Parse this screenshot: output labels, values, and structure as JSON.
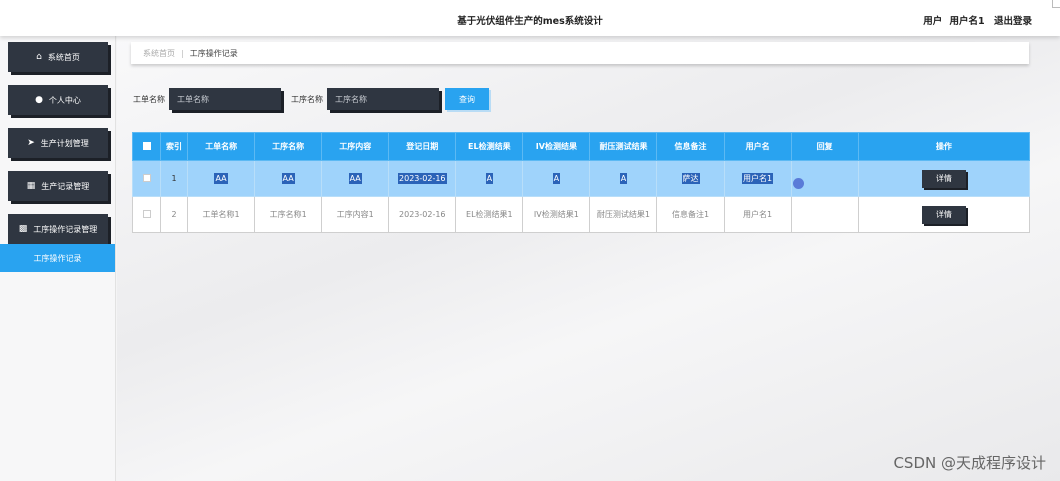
{
  "header": {
    "title": "基于光伏组件生产的mes系统设计",
    "user_label": "用户",
    "user_name": "用户名1",
    "logout": "退出登录"
  },
  "sidebar": {
    "items": [
      {
        "label": "系统首页",
        "icon": "home-icon"
      },
      {
        "label": "个人中心",
        "icon": "user-icon"
      },
      {
        "label": "生产计划管理",
        "icon": "send-icon"
      },
      {
        "label": "生产记录管理",
        "icon": "grid-icon"
      },
      {
        "label": "工序操作记录管理",
        "icon": "clipboard-icon"
      }
    ],
    "active_sub": "工序操作记录"
  },
  "breadcrumb": {
    "home": "系统首页",
    "current": "工序操作记录"
  },
  "search": {
    "field1_label": "工单名称",
    "field1_placeholder": "工单名称",
    "field2_label": "工序名称",
    "field2_placeholder": "工序名称",
    "button": "查询"
  },
  "table": {
    "columns": [
      "索引",
      "工单名称",
      "工序名称",
      "工序内容",
      "登记日期",
      "EL检测结果",
      "IV检测结果",
      "耐压测试结果",
      "信息备注",
      "用户名",
      "回复",
      "操作"
    ],
    "rows": [
      {
        "index": "1",
        "cells": [
          "AA",
          "AA",
          "AA",
          "2023-02-16",
          "A",
          "A",
          "A",
          "萨达",
          "用户名1",
          ""
        ],
        "action": "详情",
        "selected": true
      },
      {
        "index": "2",
        "cells": [
          "工单名称1",
          "工序名称1",
          "工序内容1",
          "2023-02-16",
          "EL检测结果1",
          "IV检测结果1",
          "耐压测试结果1",
          "信息备注1",
          "用户名1",
          ""
        ],
        "action": "详情",
        "selected": false
      }
    ]
  },
  "watermark": "CSDN @天成程序设计",
  "colors": {
    "accent": "#29a3f0",
    "dark": "#2f3641",
    "selected_row": "#9fd3fb"
  }
}
